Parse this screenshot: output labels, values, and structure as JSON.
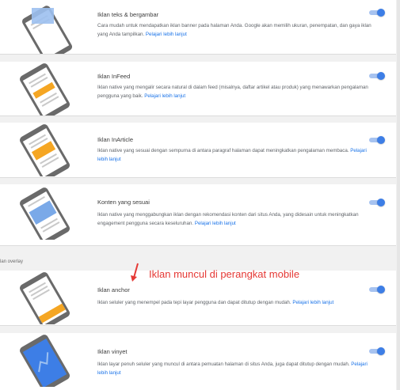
{
  "cards": [
    {
      "title": "Iklan teks & bergambar",
      "desc": "Cara mudah untuk mendapatkan iklan banner pada halaman Anda. Google akan memilih ukuran, penempatan, dan gaya iklan yang Anda tampilkan.",
      "link": "Pelajari lebih lanjut",
      "enabled": true,
      "icon": "text-image-ad-icon"
    },
    {
      "title": "Iklan InFeed",
      "desc": "Iklan native yang mengalir secara natural di dalam feed (misalnya, daftar artikel atau produk) yang menawarkan pengalaman pengguna yang baik.",
      "link": "Pelajari lebih lanjut",
      "enabled": true,
      "icon": "infeed-ad-icon"
    },
    {
      "title": "Iklan InArticle",
      "desc": "Iklan native yang sesuai dengan sempurna di antara paragraf halaman dapat meningkatkan pengalaman membaca.",
      "link": "Pelajari lebih lanjut",
      "enabled": true,
      "icon": "inarticle-ad-icon"
    },
    {
      "title": "Konten yang sesuai",
      "desc": "Iklan native yang menggabungkan iklan dengan rekomendasi konten dari situs Anda, yang didesain untuk meningkatkan engagement pengguna secara keseluruhan.",
      "link": "Pelajari lebih lanjut",
      "enabled": true,
      "icon": "matched-content-icon"
    },
    {
      "title": "Iklan anchor",
      "desc": "Iklan seluler yang menempel pada tepi layar pengguna dan dapat ditutup dengan mudah.",
      "link": "Pelajari lebih lanjut",
      "enabled": true,
      "icon": "anchor-ad-icon"
    },
    {
      "title": "Iklan vinyet",
      "desc": "Iklan layar penuh seluler yang muncul di antara pemuatan halaman di situs Anda, juga dapat ditutup dengan mudah.",
      "link": "Pelajari lebih lanjut",
      "enabled": true,
      "icon": "vignette-ad-icon"
    }
  ],
  "section_label": "lan overlay",
  "annotation": "Iklan muncul di perangkat mobile",
  "colors": {
    "accent": "#3d7ee6",
    "link": "#1a73e8",
    "annotation": "#e53935",
    "ad_orange": "#f5a623",
    "ad_blue": "#7aa9e8"
  }
}
